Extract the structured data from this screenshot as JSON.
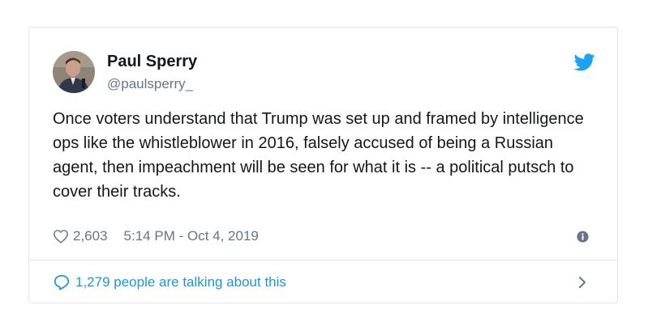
{
  "author": {
    "name": "Paul Sperry",
    "handle": "@paulsperry_"
  },
  "tweet": {
    "text": "Once voters understand that Trump was set up and framed by intelligence ops like the whistleblower in 2016, falsely accused of being a Russian agent, then impeachment will be seen for what it is -- a political putsch to cover their tracks."
  },
  "meta": {
    "likes": "2,603",
    "timestamp": "5:14 PM - Oct 4, 2019"
  },
  "footer": {
    "talking": "1,279 people are talking about this"
  },
  "icons": {
    "brand": "twitter-bird-icon",
    "like": "heart-icon",
    "info": "info-icon",
    "reply": "speech-bubble-icon",
    "more": "chevron-right-icon"
  },
  "colors": {
    "brand_blue": "#1da1f2",
    "link_blue": "#1b95e0",
    "text": "#14171a",
    "muted": "#657786",
    "border": "#e1e8ed"
  }
}
